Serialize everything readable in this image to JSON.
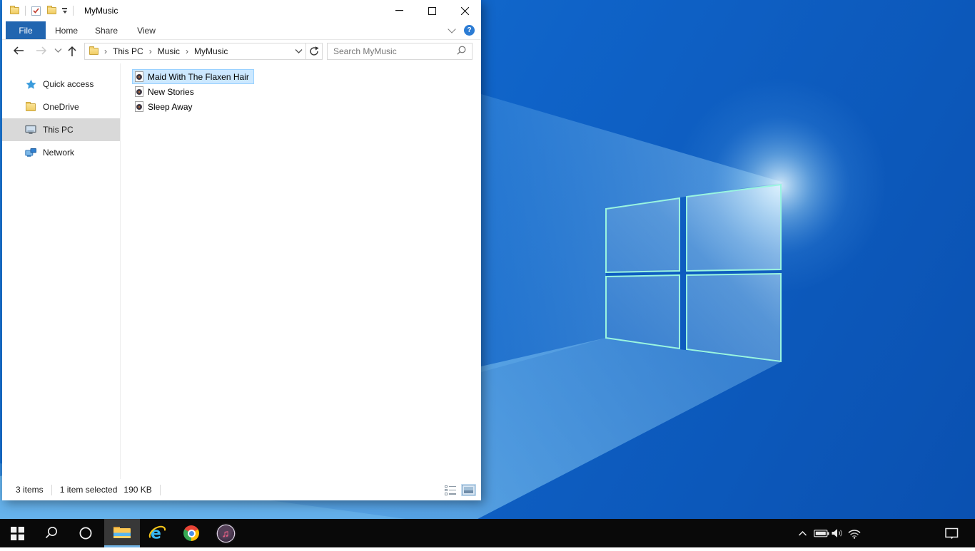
{
  "window": {
    "title": "MyMusic",
    "tabs": {
      "file": "File",
      "home": "Home",
      "share": "Share",
      "view": "View"
    },
    "nav": {
      "crumbs": [
        "This PC",
        "Music",
        "MyMusic"
      ],
      "search_placeholder": "Search MyMusic"
    },
    "sidebar": {
      "items": [
        {
          "label": "Quick access",
          "icon": "star-icon",
          "selected": false
        },
        {
          "label": "OneDrive",
          "icon": "onedrive-folder-icon",
          "selected": false
        },
        {
          "label": "This PC",
          "icon": "monitor-icon",
          "selected": true
        },
        {
          "label": "Network",
          "icon": "network-icon",
          "selected": false
        }
      ]
    },
    "files": [
      {
        "name": "Maid With The Flaxen Hair",
        "icon": "music-file-icon",
        "selected": true
      },
      {
        "name": "New Stories",
        "icon": "music-file-icon",
        "selected": false
      },
      {
        "name": "Sleep Away",
        "icon": "music-file-icon",
        "selected": false
      }
    ],
    "status": {
      "count": "3 items",
      "selection": "1 item selected",
      "size": "190 KB"
    }
  },
  "taskbar": {
    "buttons": [
      "start",
      "search",
      "cortana",
      "file-explorer",
      "internet-explorer",
      "chrome",
      "itunes"
    ],
    "active_button": "file-explorer",
    "tray": [
      "tray-expand",
      "battery",
      "volume",
      "wifi",
      "action-center"
    ]
  },
  "colors": {
    "accent": "#0078d7",
    "file_tab": "#2165b0",
    "selection_fill": "#cce8ff",
    "selection_border": "#99d1ff",
    "sidebar_selected": "#d9d9d9",
    "taskbar": "#090909",
    "wallpaper_base": "#0d5fc6"
  }
}
